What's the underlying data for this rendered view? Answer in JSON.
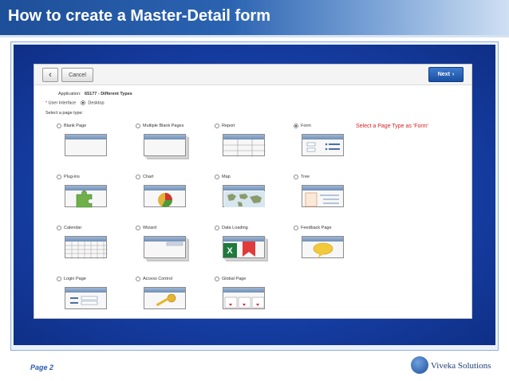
{
  "slide": {
    "title": "How to create a Master-Detail form",
    "page_label": "Page 2",
    "brand": "Viveka Solutions"
  },
  "toolbar": {
    "back_icon": "‹",
    "cancel_label": "Cancel",
    "next_label": "Next",
    "next_icon": "›"
  },
  "meta": {
    "application_label": "Application:",
    "application_value": "65177 - Different Types",
    "ui_label": "User Interface",
    "ui_value": "Desktop",
    "select_label": "Select a page type:"
  },
  "page_types": [
    {
      "label": "Blank Page",
      "selected": false,
      "icon": "blank-page-icon"
    },
    {
      "label": "Multiple Blank Pages",
      "selected": false,
      "icon": "multiple-blank-pages-icon"
    },
    {
      "label": "Report",
      "selected": false,
      "icon": "report-icon"
    },
    {
      "label": "Form",
      "selected": true,
      "icon": "form-icon"
    },
    {
      "label": "Plug-ins",
      "selected": false,
      "icon": "plugins-icon"
    },
    {
      "label": "Chart",
      "selected": false,
      "icon": "chart-icon"
    },
    {
      "label": "Map",
      "selected": false,
      "icon": "map-icon"
    },
    {
      "label": "Tree",
      "selected": false,
      "icon": "tree-icon"
    },
    {
      "label": "Calendar",
      "selected": false,
      "icon": "calendar-icon"
    },
    {
      "label": "Wizard",
      "selected": false,
      "icon": "wizard-icon"
    },
    {
      "label": "Data Loading",
      "selected": false,
      "icon": "data-loading-icon"
    },
    {
      "label": "Feedback Page",
      "selected": false,
      "icon": "feedback-page-icon"
    },
    {
      "label": "Login Page",
      "selected": false,
      "icon": "login-page-icon"
    },
    {
      "label": "Access Control",
      "selected": false,
      "icon": "access-control-icon"
    },
    {
      "label": "Global Page",
      "selected": false,
      "icon": "global-page-icon"
    }
  ],
  "annotation": "Select a Page Type as 'Form'"
}
